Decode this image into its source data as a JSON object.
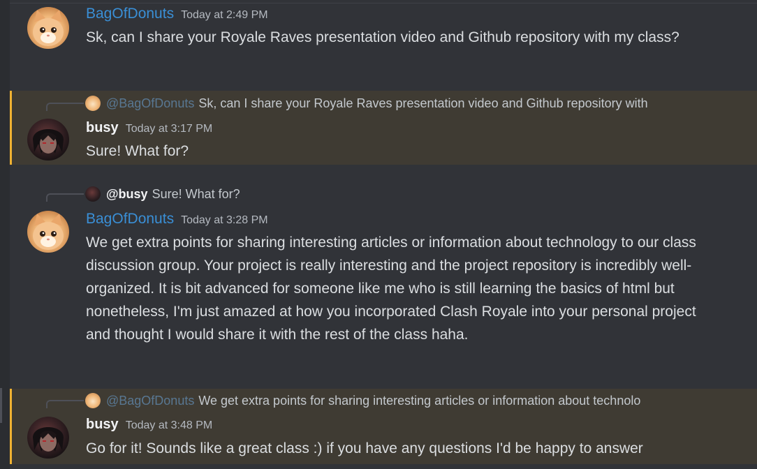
{
  "messages": [
    {
      "author": "BagOfDonuts",
      "timestamp": "Today at 2:49 PM",
      "text": "Sk, can I share your Royale Raves presentation video and Github repository with my class?",
      "avatar_icon": "cat-avatar-icon"
    },
    {
      "author": "busy",
      "timestamp": "Today at 3:17 PM",
      "text": "Sure! What for?",
      "avatar_icon": "busy-avatar-icon",
      "reply": {
        "mention": "@BagOfDonuts",
        "preview": "Sk, can I share your Royale Raves presentation video and Github repository with"
      },
      "highlighted": true
    },
    {
      "author": "BagOfDonuts",
      "timestamp": "Today at 3:28 PM",
      "text": "We get extra points for sharing interesting articles or information about technology to our class discussion group. Your project is really interesting and the project repository is incredibly well-organized. It is bit advanced for someone like me who is still learning the basics of html but nonetheless, I'm just amazed at how you incorporated Clash Royale into your personal project and thought I would share it with the rest of  the class haha.",
      "avatar_icon": "cat-avatar-icon",
      "reply": {
        "mention": "@busy",
        "preview": "Sure! What for?"
      }
    },
    {
      "author": "busy",
      "timestamp": "Today at 3:48 PM",
      "text": "Go for it! Sounds like a great class :) if you have any questions I'd be happy to answer",
      "avatar_icon": "busy-avatar-icon",
      "reply": {
        "mention": "@BagOfDonuts",
        "preview": "We get extra points for sharing interesting articles or information about technolo"
      },
      "highlighted": true
    }
  ],
  "colors": {
    "background": "#313338",
    "highlight_bg": "#3f3b33",
    "highlight_bar": "#f0b232",
    "username_blue": "#3a8fd6"
  }
}
